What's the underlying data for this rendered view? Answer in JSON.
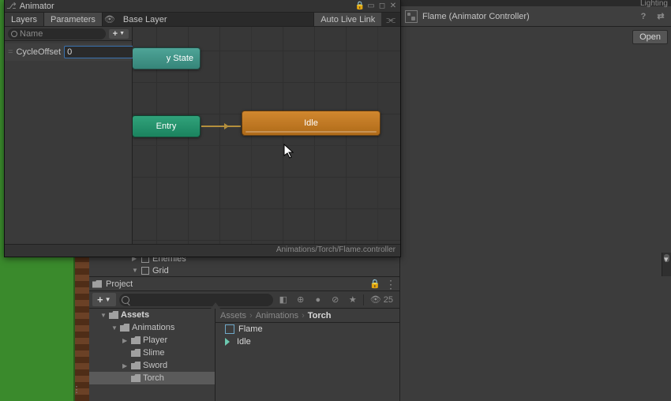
{
  "animator": {
    "title": "Animator",
    "tabs": {
      "layers": "Layers",
      "parameters": "Parameters"
    },
    "breadcrumb": "Base Layer",
    "livelink": "Auto Live Link",
    "search_placeholder": "Name",
    "param": {
      "label": "CycleOffset",
      "value": "0"
    },
    "nodes": {
      "anystate_suffix": "y State",
      "entry": "Entry",
      "idle": "Idle"
    },
    "footer_path": "Animations/Torch/Flame.controller"
  },
  "inspector": {
    "top_tab_frag": "Lighting",
    "title": "Flame (Animator Controller)",
    "open": "Open"
  },
  "hierarchy": {
    "item1": "Enemies",
    "item2": "Grid"
  },
  "project": {
    "title": "Project",
    "count": "25",
    "tree": {
      "root": "Assets",
      "animations": "Animations",
      "player": "Player",
      "slime": "Slime",
      "sword": "Sword",
      "torch": "Torch"
    },
    "breadcrumb": {
      "b1": "Assets",
      "b2": "Animations",
      "b3": "Torch"
    },
    "files": {
      "flame": "Flame",
      "idle": "Idle"
    }
  }
}
